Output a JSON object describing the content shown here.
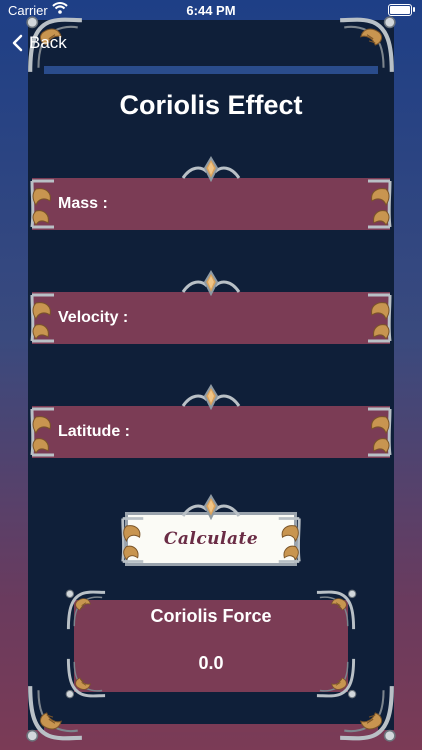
{
  "status_bar": {
    "carrier": "Carrier",
    "time": "6:44 PM",
    "battery_level": 1.0
  },
  "nav": {
    "back_label": "Back"
  },
  "title": "Coriolis Effect",
  "fields": [
    {
      "label": "Mass :",
      "value": ""
    },
    {
      "label": "Velocity :",
      "value": ""
    },
    {
      "label": "Latitude :",
      "value": ""
    }
  ],
  "calculate_label": "Calculate",
  "result": {
    "label": "Coriolis Force",
    "value": "0.0"
  },
  "colors": {
    "panel": "#0f1f39",
    "field": "#7b3c55",
    "button_bg": "#fbfbf6",
    "button_text": "#6a2c45",
    "ornament_silver": "#b9c0c6",
    "ornament_gold": "#c89550"
  },
  "icons": {
    "back": "chevron-left-icon",
    "wifi": "wifi-icon",
    "battery": "battery-icon",
    "ornament": "ornate-corner-icon"
  }
}
